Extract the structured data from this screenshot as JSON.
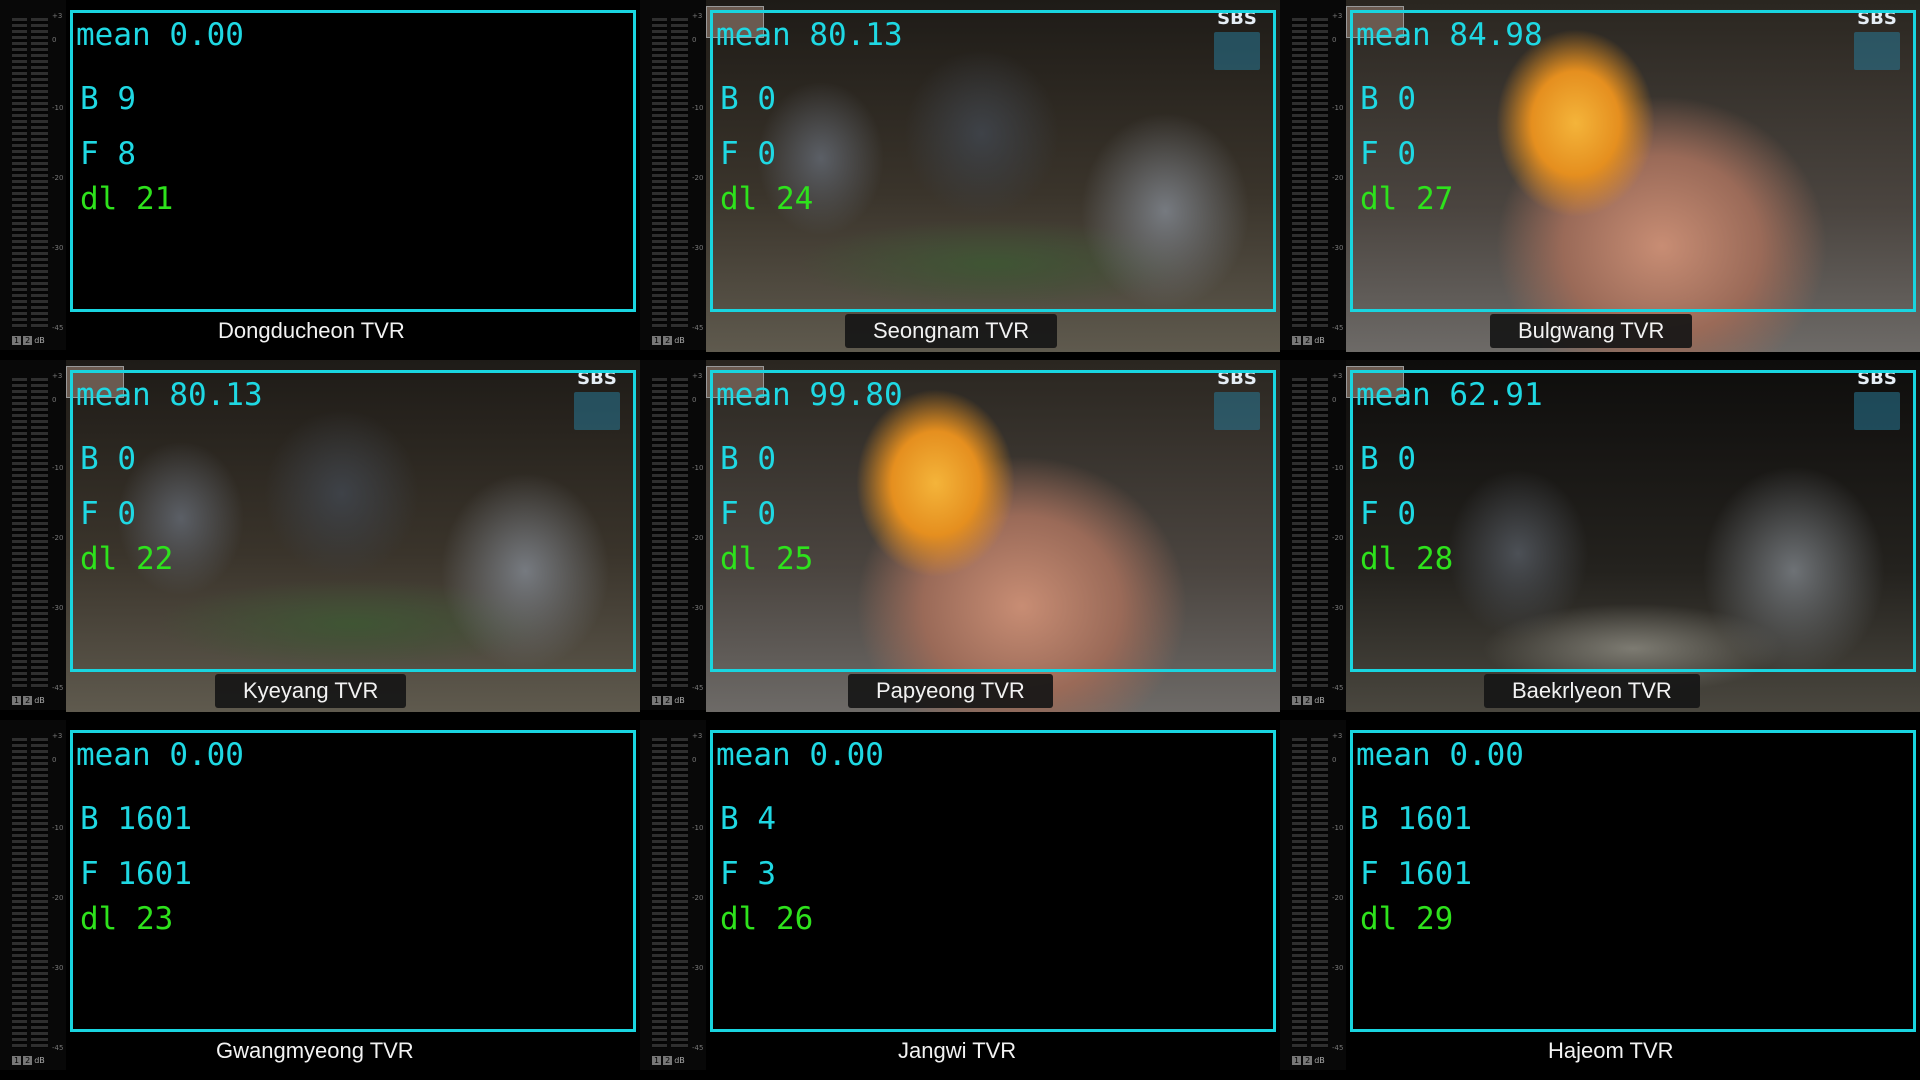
{
  "meter": {
    "scale": [
      "+3",
      "0",
      "-10",
      "-20",
      "-30",
      "-45"
    ],
    "ch1": "1",
    "ch2": "2",
    "unit": "dB"
  },
  "cells": [
    {
      "name": "Dongducheon TVR",
      "mean": "mean 0.00",
      "b": "B 9",
      "f": "F 8",
      "dl": "dl 21",
      "video": "black"
    },
    {
      "name": "Seongnam TVR",
      "mean": "mean 80.13",
      "b": "B 0",
      "f": "F 0",
      "dl": "dl 24",
      "video": "crowd"
    },
    {
      "name": "Bulgwang TVR",
      "mean": "mean 84.98",
      "b": "B 0",
      "f": "F 0",
      "dl": "dl 27",
      "video": "food"
    },
    {
      "name": "Kyeyang TVR",
      "mean": "mean 80.13",
      "b": "B 0",
      "f": "F 0",
      "dl": "dl 22",
      "video": "night"
    },
    {
      "name": "Papyeong TVR",
      "mean": "mean 99.80",
      "b": "B 0",
      "f": "F 0",
      "dl": "dl 25",
      "video": "food"
    },
    {
      "name": "Baekrlyeon TVR",
      "mean": "mean 62.91",
      "b": "B 0",
      "f": "F 0",
      "dl": "dl 28",
      "video": "night"
    },
    {
      "name": "Gwangmyeong TVR",
      "mean": "mean 0.00",
      "b": "B 1601",
      "f": "F 1601",
      "dl": "dl 23",
      "video": "black"
    },
    {
      "name": "Jangwi TVR",
      "mean": "mean 0.00",
      "b": "B 4",
      "f": "F 3",
      "dl": "dl 26",
      "video": "black"
    },
    {
      "name": "Hajeom TVR",
      "mean": "mean 0.00",
      "b": "B 1601",
      "f": "F 1601",
      "dl": "dl 29",
      "video": "black"
    }
  ],
  "broadcaster_logo": "SBS",
  "colors": {
    "roi_border": "#19d5e0",
    "stat_text": "#1fd8e3",
    "dl_text": "#2ee21c"
  }
}
